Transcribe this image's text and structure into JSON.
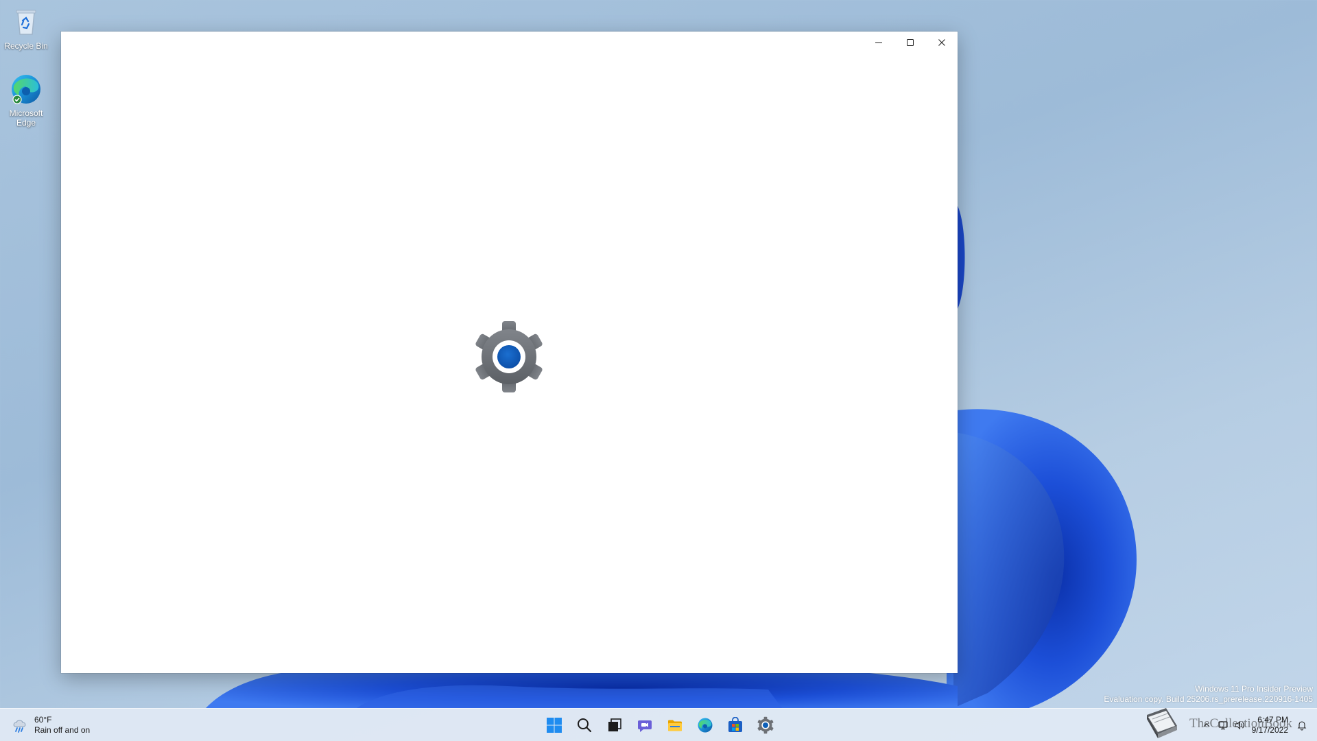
{
  "desktop": {
    "icons": [
      {
        "label": "Recycle Bin",
        "icon": "recycle-bin-icon"
      },
      {
        "label": "Microsoft Edge",
        "icon": "edge-icon"
      }
    ]
  },
  "window": {
    "app": "Settings",
    "state": "loading-splash",
    "splash_icon": "settings-gear-icon",
    "caption_buttons": [
      "minimize-icon",
      "maximize-icon",
      "close-icon"
    ]
  },
  "watermark": {
    "line1": "Windows 11 Pro Insider Preview",
    "line2": "Evaluation copy. Build 25206.rs_prerelease.220916-1405"
  },
  "taskbar": {
    "weather": {
      "temperature": "60°F",
      "condition": "Rain off and on",
      "icon": "rain-cloud-icon"
    },
    "apps": [
      {
        "name": "start",
        "icon": "windows-logo-icon"
      },
      {
        "name": "search",
        "icon": "search-icon"
      },
      {
        "name": "task-view",
        "icon": "task-view-icon"
      },
      {
        "name": "chat",
        "icon": "teams-chat-icon"
      },
      {
        "name": "file-explorer",
        "icon": "folder-icon"
      },
      {
        "name": "edge",
        "icon": "edge-icon"
      },
      {
        "name": "store",
        "icon": "store-icon"
      },
      {
        "name": "settings",
        "icon": "gear-icon"
      }
    ],
    "tray": {
      "icons": [
        "chevron-up-icon",
        "network-icon",
        "volume-icon"
      ],
      "time": "6:47 PM",
      "date": "9/17/2022",
      "notification_icon": "notification-bell-icon"
    },
    "overlay_logo_text": "TheCollectionBook"
  },
  "colors": {
    "accent": "#0067c0",
    "gear_gray": "#6d7075",
    "wallpaper_blue": "#1f4fd6"
  }
}
